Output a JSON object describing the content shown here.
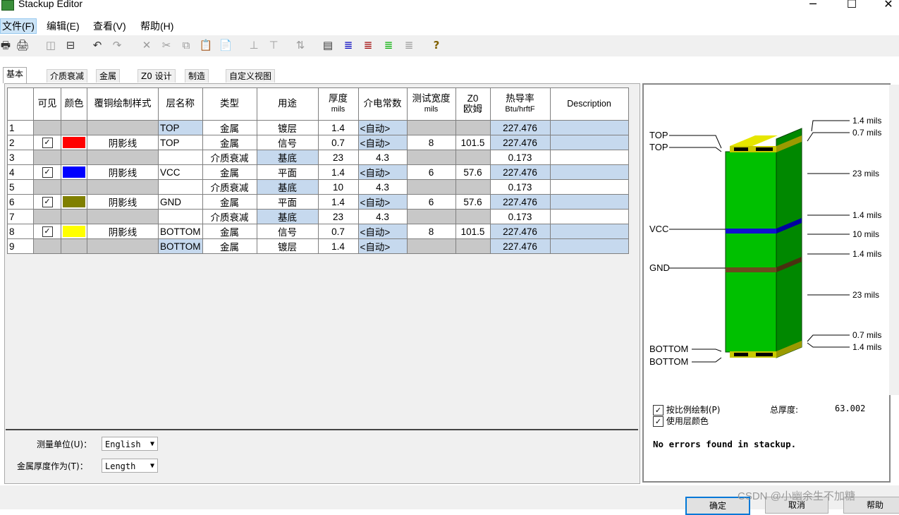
{
  "window": {
    "title": "Stackup Editor",
    "minimize": "─",
    "maximize": "☐",
    "close": "✕"
  },
  "menu": [
    {
      "label": "文件(F)",
      "active": true
    },
    {
      "label": "编辑(E)",
      "active": false
    },
    {
      "label": "查看(V)",
      "active": false
    },
    {
      "label": "帮助(H)",
      "active": false
    }
  ],
  "toolbar": {
    "icons": [
      "print-icon",
      "print-preview-icon",
      "split-vertical-icon",
      "split-horizontal-icon",
      "undo-icon",
      "redo-icon",
      "delete-icon",
      "cut-icon",
      "copy-icon",
      "paste-icon",
      "paste-special-icon",
      "insert-above-icon",
      "insert-below-icon",
      "sort-icon",
      "layer-stack-icon",
      "lines-blue-icon",
      "lines-red-icon",
      "lines-green-icon",
      "lines-gray-icon",
      "help-icon"
    ],
    "help_glyph": "?"
  },
  "tabs": [
    "基本",
    "介质衰减",
    "金属",
    "Z0 设计",
    "制造",
    "自定义视图"
  ],
  "grid": {
    "headers": [
      "可见",
      "颜色",
      "覆铜绘制样式",
      "层名称",
      "类型",
      "用途",
      "厚度",
      "介电常数",
      "测试宽度",
      "Z0",
      "热导率",
      "Description"
    ],
    "header_sub": {
      "thickness": "mils",
      "test_width": "mils",
      "z0": "欧姆",
      "thermal": "Btu/hrftF"
    },
    "rows": [
      {
        "num": "1",
        "visible": false,
        "color": "",
        "style": "",
        "name": "TOP",
        "type": "金属",
        "use": "镀层",
        "thick": "1.4",
        "dk": "<自动>",
        "width": "",
        "z0": "",
        "thermal": "227.476",
        "desc": ""
      },
      {
        "num": "2",
        "visible": true,
        "color": "#ff0000",
        "style": "阴影线",
        "name": "TOP",
        "type": "金属",
        "use": "信号",
        "thick": "0.7",
        "dk": "<自动>",
        "width": "8",
        "z0": "101.5",
        "thermal": "227.476",
        "desc": ""
      },
      {
        "num": "3",
        "visible": false,
        "color": "",
        "style": "",
        "name": "",
        "type": "介质衰减",
        "use": "基底",
        "thick": "23",
        "dk": "4.3",
        "width": "",
        "z0": "",
        "thermal": "0.173",
        "desc": ""
      },
      {
        "num": "4",
        "visible": true,
        "color": "#0000ff",
        "style": "阴影线",
        "name": "VCC",
        "type": "金属",
        "use": "平面",
        "thick": "1.4",
        "dk": "<自动>",
        "width": "6",
        "z0": "57.6",
        "thermal": "227.476",
        "desc": ""
      },
      {
        "num": "5",
        "visible": false,
        "color": "",
        "style": "",
        "name": "",
        "type": "介质衰减",
        "use": "基底",
        "thick": "10",
        "dk": "4.3",
        "width": "",
        "z0": "",
        "thermal": "0.173",
        "desc": ""
      },
      {
        "num": "6",
        "visible": true,
        "color": "#808000",
        "style": "阴影线",
        "name": "GND",
        "type": "金属",
        "use": "平面",
        "thick": "1.4",
        "dk": "<自动>",
        "width": "6",
        "z0": "57.6",
        "thermal": "227.476",
        "desc": ""
      },
      {
        "num": "7",
        "visible": false,
        "color": "",
        "style": "",
        "name": "",
        "type": "介质衰减",
        "use": "基底",
        "thick": "23",
        "dk": "4.3",
        "width": "",
        "z0": "",
        "thermal": "0.173",
        "desc": ""
      },
      {
        "num": "8",
        "visible": true,
        "color": "#ffff00",
        "style": "阴影线",
        "name": "BOTTOM",
        "type": "金属",
        "use": "信号",
        "thick": "0.7",
        "dk": "<自动>",
        "width": "8",
        "z0": "101.5",
        "thermal": "227.476",
        "desc": ""
      },
      {
        "num": "9",
        "visible": false,
        "color": "",
        "style": "",
        "name": "BOTTOM",
        "type": "金属",
        "use": "镀层",
        "thick": "1.4",
        "dk": "<自动>",
        "width": "",
        "z0": "",
        "thermal": "227.476",
        "desc": ""
      }
    ]
  },
  "units": {
    "measure_label": "测量单位(U)：",
    "measure_value": "English",
    "metal_label": "金属厚度作为(T)：",
    "metal_value": "Length"
  },
  "stackup_view": {
    "left_labels": [
      "TOP",
      "TOP",
      "VCC",
      "GND",
      "BOTTOM",
      "BOTTOM"
    ],
    "right_labels": [
      "1.4 mils",
      "0.7 mils",
      "23 mils",
      "1.4 mils",
      "10 mils",
      "1.4 mils",
      "23 mils",
      "0.7 mils",
      "1.4 mils"
    ],
    "colors": {
      "dielectric": "#00c000",
      "dielectric_side": "#008800",
      "copper": "#c8c800",
      "copper_top": "#e6e600",
      "vcc": "#1010d0",
      "gnd": "#6b4a1e"
    }
  },
  "options": {
    "scale_label": "按比例绘制(P)",
    "scale_checked": true,
    "layercolor_label": "使用层颜色",
    "layercolor_checked": true,
    "total_label": "总厚度:",
    "total_value": "63.002"
  },
  "status": "No errors found in stackup.",
  "buttons": {
    "ok": "确定",
    "cancel": "取消",
    "help": "帮助"
  },
  "watermark": "CSDN @小幽余生不加糖"
}
